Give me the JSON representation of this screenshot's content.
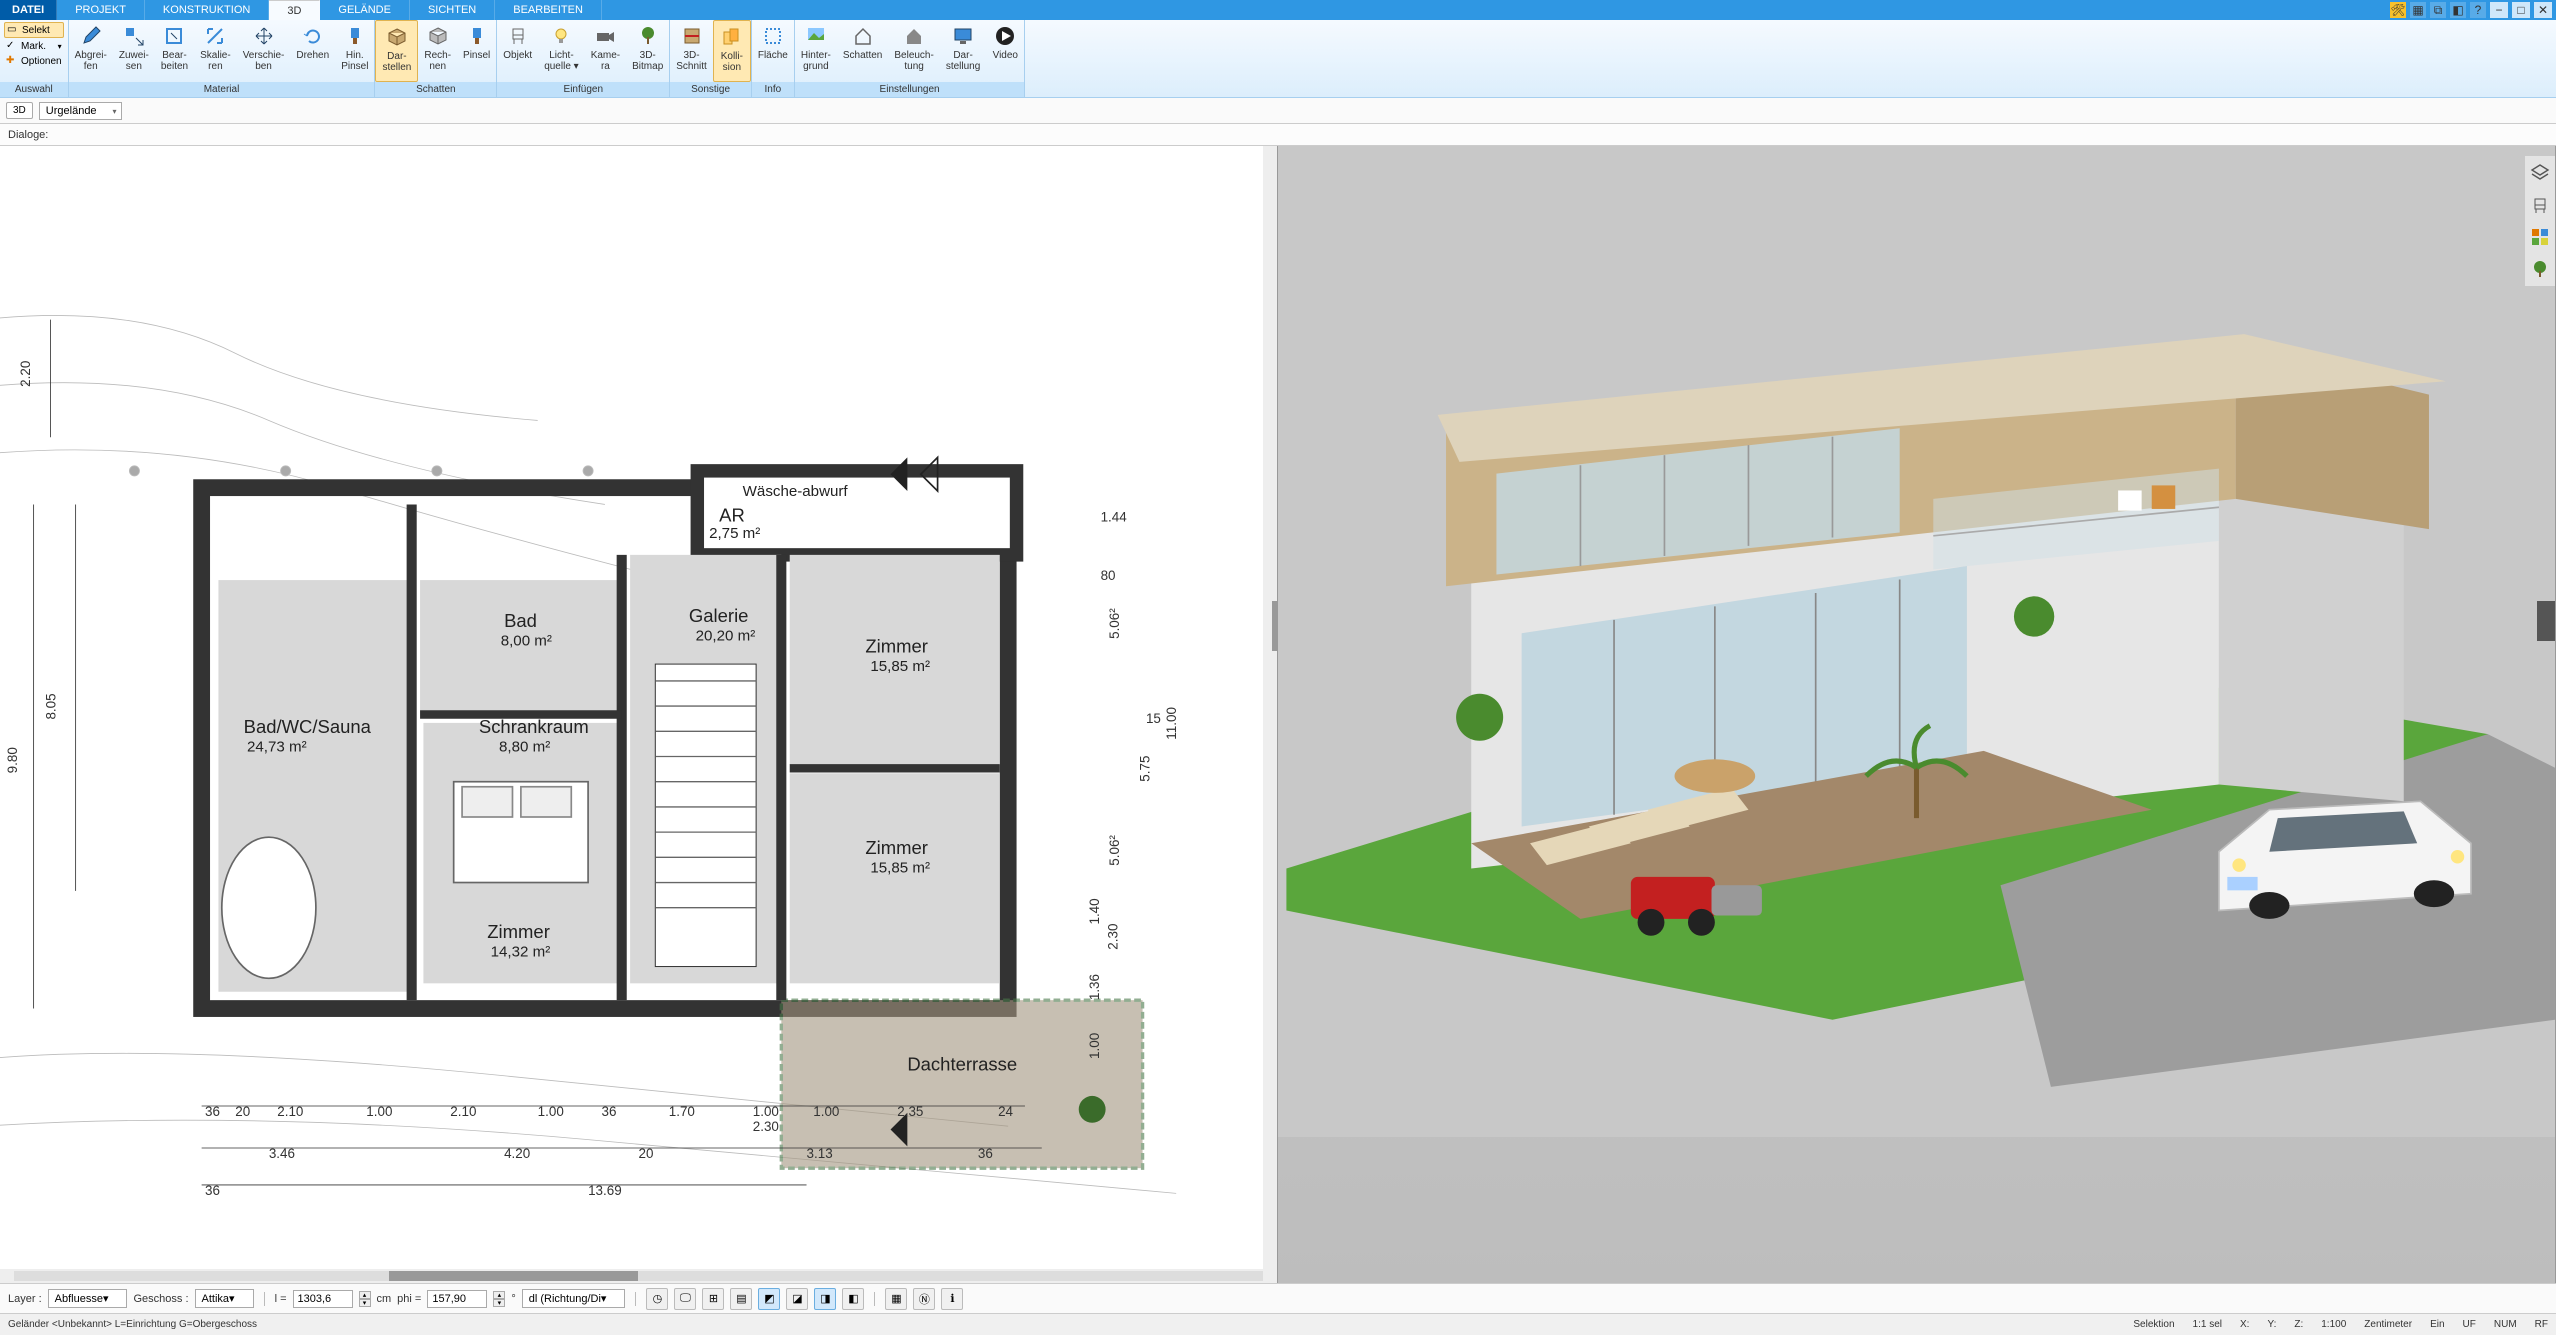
{
  "menu": {
    "file": "DATEI",
    "tabs": [
      "PROJEKT",
      "KONSTRUKTION",
      "3D",
      "GELÄNDE",
      "SICHTEN",
      "BEARBEITEN"
    ],
    "active": "3D"
  },
  "ribbon": {
    "auswahl": {
      "selekt": "Selekt",
      "mark": "Mark.",
      "optionen": "Optionen",
      "label": "Auswahl"
    },
    "material": {
      "buttons": [
        {
          "l1": "Abgrei-",
          "l2": "fen"
        },
        {
          "l1": "Zuwei-",
          "l2": "sen"
        },
        {
          "l1": "Bear-",
          "l2": "beiten"
        },
        {
          "l1": "Skalie-",
          "l2": "ren"
        },
        {
          "l1": "Verschie-",
          "l2": "ben"
        },
        {
          "l1": "Drehen",
          "l2": ""
        },
        {
          "l1": "Hin.",
          "l2": "Pinsel"
        }
      ],
      "label": "Material"
    },
    "schatten": {
      "buttons": [
        {
          "l1": "Dar-",
          "l2": "stellen",
          "active": true
        },
        {
          "l1": "Rech-",
          "l2": "nen"
        },
        {
          "l1": "Pinsel",
          "l2": ""
        }
      ],
      "label": "Schatten"
    },
    "einfuegen": {
      "buttons": [
        {
          "l1": "Objekt",
          "l2": ""
        },
        {
          "l1": "Licht-",
          "l2": "quelle",
          "dd": true
        },
        {
          "l1": "Kame-",
          "l2": "ra"
        },
        {
          "l1": "3D-",
          "l2": "Bitmap"
        }
      ],
      "label": "Einfügen"
    },
    "sonstige": {
      "buttons": [
        {
          "l1": "3D-",
          "l2": "Schnitt"
        },
        {
          "l1": "Kolli-",
          "l2": "sion",
          "active": true
        }
      ],
      "label": "Sonstige"
    },
    "info": {
      "buttons": [
        {
          "l1": "Fläche",
          "l2": ""
        }
      ],
      "label": "Info"
    },
    "einstellungen": {
      "buttons": [
        {
          "l1": "Hinter-",
          "l2": "grund"
        },
        {
          "l1": "Schatten",
          "l2": ""
        },
        {
          "l1": "Beleuch-",
          "l2": "tung"
        },
        {
          "l1": "Dar-",
          "l2": "stellung"
        },
        {
          "l1": "Video",
          "l2": ""
        }
      ],
      "label": "Einstellungen"
    }
  },
  "subbar": {
    "mode": "3D",
    "terrain": "Urgelände"
  },
  "dialoge": {
    "label": "Dialoge:"
  },
  "rooms": {
    "bad": {
      "name": "Bad",
      "area": "8,00 m²"
    },
    "galerie": {
      "name": "Galerie",
      "area": "20,20 m²"
    },
    "ar": {
      "name": "AR",
      "area": "2,75 m²"
    },
    "zimmer1": {
      "name": "Zimmer",
      "area": "15,85 m²"
    },
    "zimmer2": {
      "name": "Zimmer",
      "area": "15,85 m²"
    },
    "badwc": {
      "name": "Bad/WC/Sauna",
      "area": "24,73 m²"
    },
    "schrankraum": {
      "name": "Schrankraum",
      "area": "8,80 m²"
    },
    "zimmer3": {
      "name": "Zimmer",
      "area": "14,32 m²"
    },
    "dachterrasse": {
      "name": "Dachterrasse"
    },
    "waesche": "Wäsche-abwurf"
  },
  "dims": {
    "left_top": "2.20",
    "left_mid": "8.05",
    "left_bot": "9.80",
    "right_t1": "1.44",
    "right_t2": "80",
    "right_side": "5.06²",
    "right_11": "11.00",
    "right_575": "5.75",
    "right_15": "15",
    "right_506": "5.06²",
    "r_140": "1.40",
    "r_230": "2.30",
    "r_136": "1.36",
    "r_100": "1.00",
    "b_36a": "36",
    "b_20": "20",
    "b_210a": "2.10",
    "b_100a": "1.00",
    "b_210b": "2.10",
    "b_100b": "1.00",
    "b_36b": "36",
    "b_170": "1.70",
    "b_100c": "1.00",
    "b_100d": "1.00",
    "b_235": "2.35",
    "b_24": "24",
    "b2_230": "2.30",
    "b2_346": "3.46",
    "b2_420": "4.20",
    "b2_20": "20",
    "b2_313": "3.13",
    "b2_36": "36",
    "b3_1369": "13.69",
    "b3_36a": "36"
  },
  "bottombar": {
    "layer_lbl": "Layer :",
    "layer_val": "Abfluesse",
    "geschoss_lbl": "Geschoss :",
    "geschoss_val": "Attika",
    "l_lbl": "l =",
    "l_val": "1303,6",
    "l_unit": "cm",
    "phi_lbl": "phi =",
    "phi_val": "157,90",
    "phi_unit": "°",
    "dl": "dl (Richtung/Di"
  },
  "status": {
    "left": "Geländer <Unbekannt> L=Einrichtung G=Obergeschoss",
    "selektion": "Selektion",
    "sel_count": "1:1 sel",
    "x": "X:",
    "y": "Y:",
    "z": "Z:",
    "scale": "1:100",
    "unit": "Zentimeter",
    "ein": "Ein",
    "uf": "UF",
    "num": "NUM",
    "rf": "RF"
  }
}
